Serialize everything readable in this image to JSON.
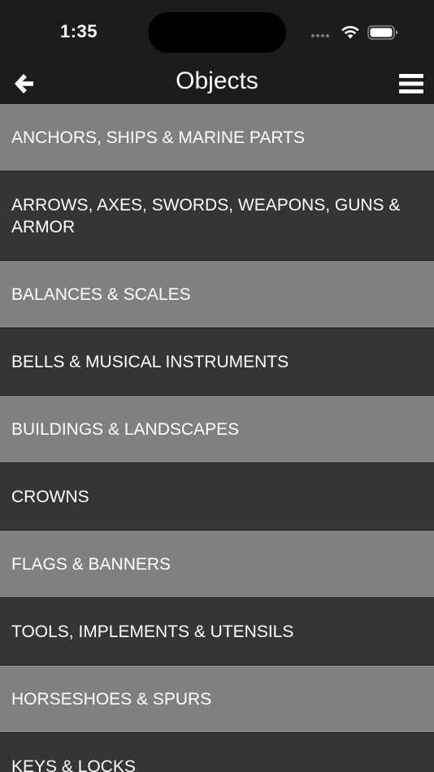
{
  "status_bar": {
    "time": "1:35"
  },
  "nav": {
    "title": "Objects",
    "back_icon": "arrow-left-icon",
    "menu_icon": "hamburger-menu-icon"
  },
  "colors": {
    "background": "#1c1c1c",
    "row_light": "#808080",
    "row_dark": "#353535",
    "text": "#ffffff"
  },
  "categories": [
    {
      "label": "ANCHORS, SHIPS & MARINE PARTS"
    },
    {
      "label": "ARROWS, AXES, SWORDS, WEAPONS, GUNS & ARMOR"
    },
    {
      "label": "BALANCES & SCALES"
    },
    {
      "label": "BELLS & MUSICAL INSTRUMENTS"
    },
    {
      "label": "BUILDINGS & LANDSCAPES"
    },
    {
      "label": "CROWNS"
    },
    {
      "label": "FLAGS & BANNERS"
    },
    {
      "label": "TOOLS, IMPLEMENTS & UTENSILS"
    },
    {
      "label": "HORSESHOES & SPURS"
    },
    {
      "label": "KEYS & LOCKS"
    }
  ]
}
